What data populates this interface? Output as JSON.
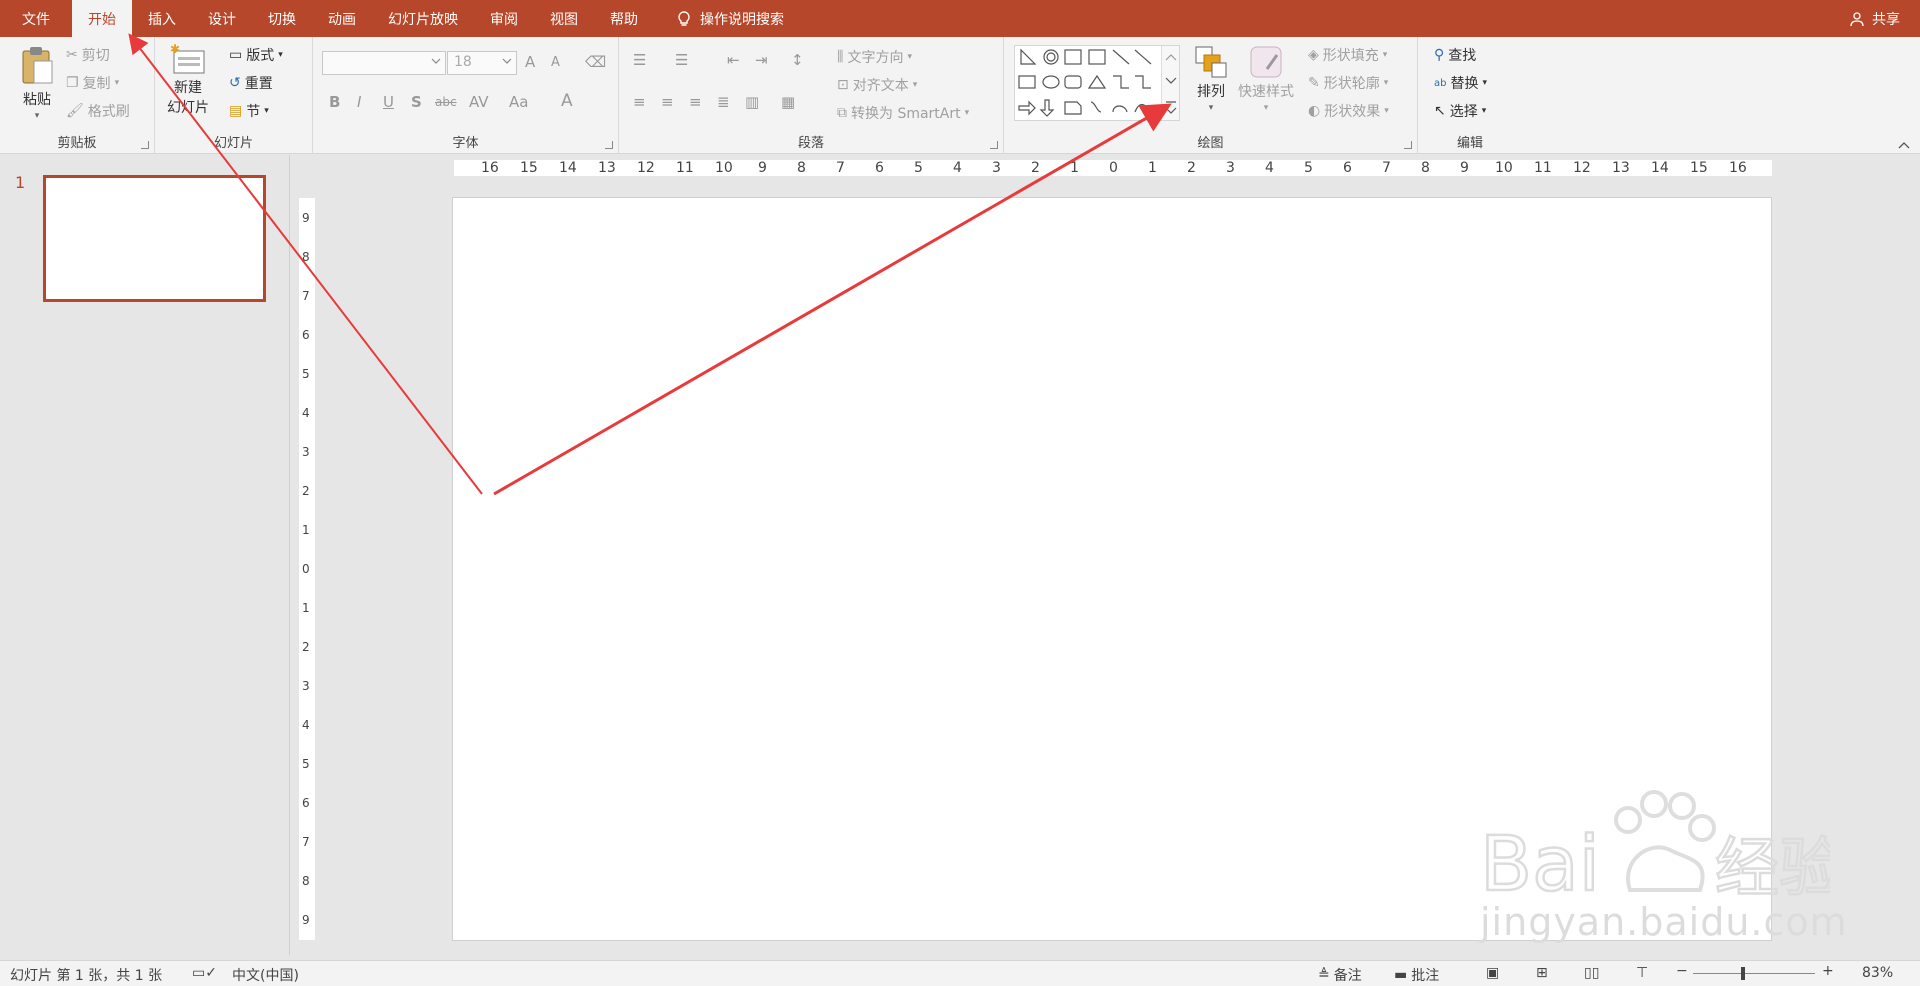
{
  "tabs": {
    "file": "文件",
    "items": [
      "开始",
      "插入",
      "设计",
      "切换",
      "动画",
      "幻灯片放映",
      "审阅",
      "视图",
      "帮助"
    ],
    "tell_me": "操作说明搜索",
    "share": "共享"
  },
  "ribbon": {
    "clipboard": {
      "label": "剪贴板",
      "paste": "粘贴",
      "cut": "剪切",
      "copy": "复制",
      "format_painter": "格式刷"
    },
    "slides": {
      "label": "幻灯片",
      "new_slide_1": "新建",
      "new_slide_2": "幻灯片",
      "layout": "版式",
      "reset": "重置",
      "section": "节"
    },
    "font": {
      "label": "字体",
      "font_name": "",
      "font_size": "18",
      "bold": "B",
      "italic": "I",
      "underline": "U",
      "shadow": "S",
      "strike": "abc",
      "spacing": "AV",
      "case": "Aa",
      "color": "A",
      "grow": "A",
      "shrink": "A"
    },
    "paragraph": {
      "label": "段落",
      "text_direction": "文字方向",
      "align_text": "对齐文本",
      "convert_smartart": "转换为 SmartArt"
    },
    "drawing": {
      "label": "绘图",
      "arrange": "排列",
      "quick_styles": "快速样式",
      "shape_fill": "形状填充",
      "shape_outline": "形状轮廓",
      "shape_effects": "形状效果"
    },
    "editing": {
      "label": "编辑",
      "find": "查找",
      "replace": "替换",
      "select": "选择"
    }
  },
  "thumbnail": {
    "number": "1"
  },
  "ruler": {
    "h_labels": [
      "16",
      "15",
      "14",
      "13",
      "12",
      "11",
      "10",
      "9",
      "8",
      "7",
      "6",
      "5",
      "4",
      "3",
      "2",
      "1",
      "0",
      "1",
      "2",
      "3",
      "4",
      "5",
      "6",
      "7",
      "8",
      "9",
      "10",
      "11",
      "12",
      "13",
      "14",
      "15",
      "16"
    ],
    "v_labels": [
      "9",
      "8",
      "7",
      "6",
      "5",
      "4",
      "3",
      "2",
      "1",
      "0",
      "1",
      "2",
      "3",
      "4",
      "5",
      "6",
      "7",
      "8",
      "9"
    ]
  },
  "watermark": {
    "text": "jingyan.baidu.com"
  },
  "status": {
    "slide_info": "幻灯片 第 1 张，共 1 张",
    "language": "中文(中国)",
    "notes": "备注",
    "comments": "批注",
    "zoom": "83%",
    "minus": "−",
    "plus": "+"
  },
  "colors": {
    "accent": "#b7472a",
    "annotation_arrow": "#e83a3a"
  }
}
